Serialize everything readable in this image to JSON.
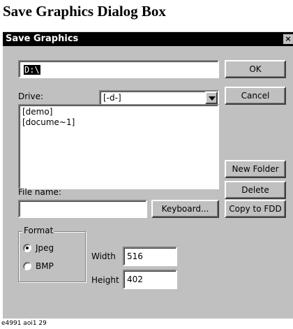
{
  "page": {
    "heading": "Save Graphics Dialog Box",
    "caption": "e4991 aoi1 29"
  },
  "dialog": {
    "title": "Save Graphics",
    "close_glyph": "×",
    "path_value": "D:\\",
    "drive_label": "Drive:",
    "drive_value": "[-d-]",
    "folders": [
      "[demo]",
      "[docume~1]"
    ],
    "filename_label": "File name:",
    "filename_value": "",
    "format": {
      "title": "Format",
      "options": [
        {
          "label": "Jpeg",
          "selected": true
        },
        {
          "label": "BMP",
          "selected": false
        }
      ]
    },
    "width_label": "Width",
    "width_value": "516",
    "height_label": "Height",
    "height_value": "402",
    "buttons": {
      "ok": "OK",
      "cancel": "Cancel",
      "new_folder": "New Folder",
      "delete": "Delete",
      "keyboard": "Keyboard...",
      "copy_fdd": "Copy to FDD"
    }
  }
}
